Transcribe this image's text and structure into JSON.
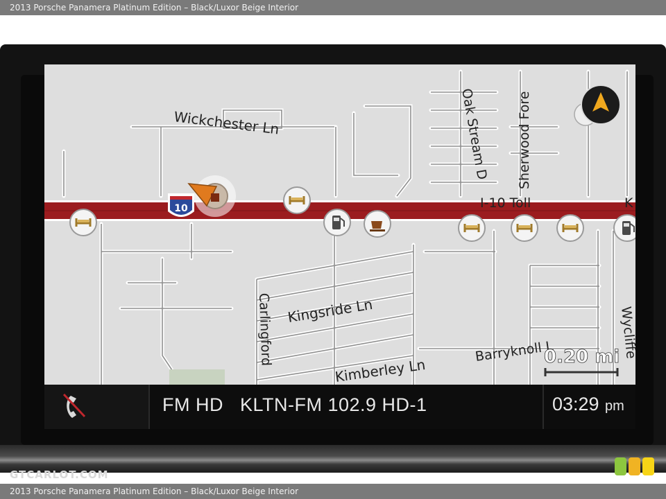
{
  "caption": {
    "top": "2013 Porsche Panamera Platinum Edition – Black/Luxor Beige Interior",
    "bottom": "2013 Porsche Panamera Platinum Edition – Black/Luxor Beige Interior"
  },
  "map": {
    "streets": {
      "wickchester": "Wickchester Ln",
      "oak_stream": "Oak Stream D",
      "sherwood": "Sherwood Fore",
      "i10_toll": "I-10 Toll",
      "k_partial": "K",
      "carlingford": "Carlingford",
      "kingsride": "Kingsride Ln",
      "kimberley": "Kimberley Ln",
      "barryknoll": "Barryknoll L",
      "wycliffe": "Wycliffe"
    },
    "highway_shield": "10",
    "scale_label": "0.20 mi",
    "compass_direction": "north-up",
    "poi_icons": [
      "hotel-icon",
      "hotel-icon",
      "fuel-icon",
      "coffee-icon",
      "hotel-icon",
      "hotel-icon",
      "hotel-icon",
      "fuel-icon"
    ],
    "colors": {
      "highway": "#9b1c1f",
      "background": "#dcdcdc",
      "roads": "#8a8a8a"
    }
  },
  "status": {
    "phone_icon": "phone-disconnected-icon",
    "band": "FM HD",
    "station": "KLTN-FM 102.9 HD-1",
    "time": "03:29",
    "ampm": "pm"
  },
  "watermark": "GTCARLOT.COM",
  "badge_colors": [
    "#8dc63f",
    "#f0b323",
    "#f7d417"
  ]
}
